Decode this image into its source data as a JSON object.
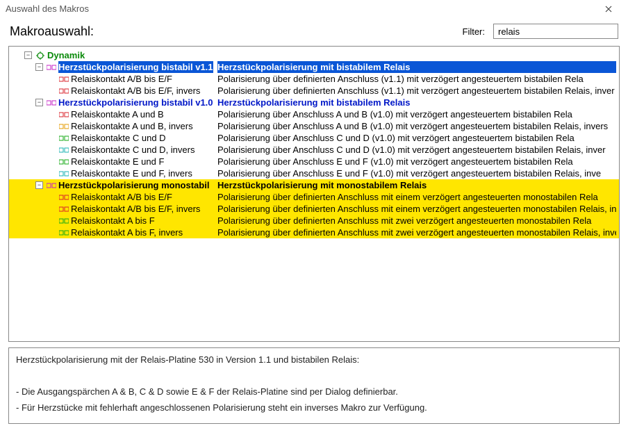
{
  "window": {
    "title": "Auswahl des Makros"
  },
  "header": {
    "title": "Makroauswahl:",
    "filter_label": "Filter:",
    "filter_value": "relais"
  },
  "tree": {
    "root": {
      "label": "Dynamik"
    },
    "g1": {
      "label": "Herzstückpolarisierung bistabil v1.1",
      "desc": "Herzstückpolarisierung mit bistabilem Relais",
      "items": [
        {
          "label": "Relaiskontakt A/B bis E/F",
          "desc": "Polarisierung über definierten Anschluss (v1.1) mit verzögert angesteuertem bistabilen Rela",
          "ic": "red"
        },
        {
          "label": "Relaiskontakt A/B bis E/F, invers",
          "desc": "Polarisierung über definierten Anschluss (v1.1) mit verzögert angesteuertem bistabilen Relais, inver",
          "ic": "red"
        }
      ]
    },
    "g2": {
      "label": "Herzstückpolarisierung bistabil v1.0",
      "desc": "Herzstückpolarisierung mit bistabilem Relais",
      "items": [
        {
          "label": "Relaiskontakte A und B",
          "desc": "Polarisierung über Anschluss A und B (v1.0) mit verzögert angesteuertem bistabilen Rela",
          "ic": "red"
        },
        {
          "label": "Relaiskontakte A und B, invers",
          "desc": "Polarisierung über Anschluss A und B (v1.0) mit verzögert angesteuertem bistabilen Relais, invers",
          "ic": "orange"
        },
        {
          "label": "Relaiskontakte C und D",
          "desc": "Polarisierung über Anschluss C und D (v1.0) mit verzögert angesteuertem bistabilen Rela",
          "ic": "green"
        },
        {
          "label": "Relaiskontakte C und D, invers",
          "desc": "Polarisierung über Anschluss C und D (v1.0) mit verzögert angesteuertem bistabilen Relais, inver",
          "ic": "cyan"
        },
        {
          "label": "Relaiskontakte E und F",
          "desc": "Polarisierung über Anschluss E und F (v1.0) mit verzögert angesteuertem bistabilen Rela",
          "ic": "green"
        },
        {
          "label": "Relaiskontakte E und F, invers",
          "desc": "Polarisierung über Anschluss E und F (v1.0) mit verzögert angesteuertem bistabilen Relais, inve",
          "ic": "cyan"
        }
      ]
    },
    "g3": {
      "label": "Herzstückpolarisierung monostabil",
      "desc": "Herzstückpolarisierung mit monostabilem Relais",
      "items": [
        {
          "label": "Relaiskontakt A/B bis E/F",
          "desc": "Polarisierung über definierten Anschluss mit einem verzögert angesteuerten monostabilen Rela",
          "ic": "red"
        },
        {
          "label": "Relaiskontakt A/B bis E/F, invers",
          "desc": "Polarisierung über definierten Anschluss mit einem verzögert angesteuerten monostabilen Relais, inve",
          "ic": "red"
        },
        {
          "label": "Relaiskontakt A bis F",
          "desc": "Polarisierung über definierten Anschluss mit zwei verzögert angesteuerten monostabilen Rela",
          "ic": "green"
        },
        {
          "label": "Relaiskontakt A bis F, invers",
          "desc": "Polarisierung über definierten Anschluss mit zwei verzögert angesteuerten monostabilen Relais, inve",
          "ic": "green"
        }
      ]
    }
  },
  "info": {
    "line1": "Herzstückpolarisierung mit der Relais-Platine 530 in Version 1.1 und bistabilen Relais:",
    "line2": "- Die Ausgangspärchen A & B, C & D sowie E & F der Relais-Platine sind per Dialog definierbar.",
    "line3": "- Für Herzstücke mit fehlerhaft angeschlossenen Polarisierung steht ein inverses Makro zur Verfügung."
  },
  "colors": {
    "red": "#d8222a",
    "orange": "#e69b00",
    "green": "#13a813",
    "cyan": "#17b2b2",
    "magenta": "#c522c5"
  }
}
